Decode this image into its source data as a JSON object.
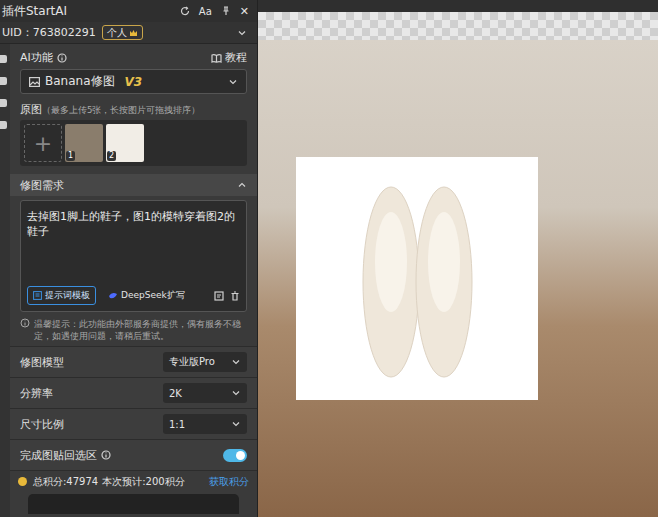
{
  "window": {
    "title": "插件StartAI",
    "font_button": "Aa",
    "close": "✕"
  },
  "account": {
    "uid": "UID：763802291",
    "badge": "个人"
  },
  "ai_function": {
    "label": "AI功能",
    "tutorial": "教程",
    "selected": "Banana修图",
    "version": "V3"
  },
  "source_images": {
    "label": "原图",
    "hint": "（最多上传5张，长按图片可拖拽排序）",
    "add": "+",
    "images": [
      {
        "index": "1",
        "color": "#8a7d6c"
      },
      {
        "index": "2",
        "color": "#f1ede6"
      }
    ]
  },
  "prompt": {
    "label": "修图需求",
    "expanded": true,
    "text": "去掉图1脚上的鞋子，图1的模特穿着图2的鞋子",
    "buttons": [
      "提示词模板",
      "DeepSeek扩写"
    ]
  },
  "notice": "温馨提示：此功能由外部服务商提供，偶有服务不稳定，如遇使用问题，请稍后重试。",
  "settings": [
    {
      "label": "修图模型",
      "kind": "select",
      "value": "专业版Pro"
    },
    {
      "label": "分辨率",
      "kind": "select",
      "value": "2K"
    },
    {
      "label": "尺寸比例",
      "kind": "select",
      "value": "1:1"
    },
    {
      "label": "完成图贴回选区",
      "kind": "toggle",
      "on": true
    }
  ],
  "footer": {
    "total": "总积分:47974",
    "estimate": "本次预计:200积分",
    "link": "获取积分"
  }
}
